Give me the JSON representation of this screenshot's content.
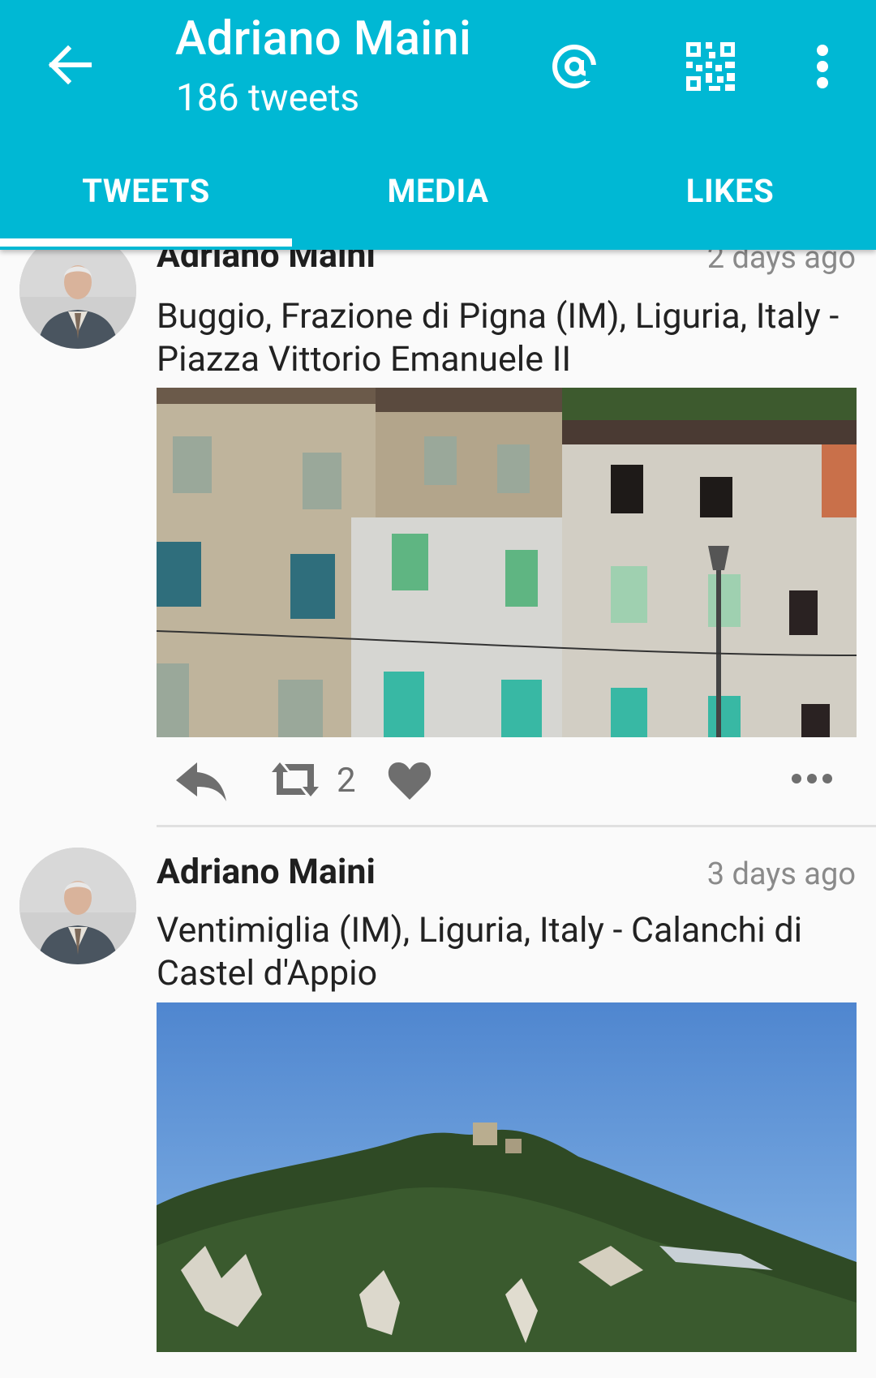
{
  "header": {
    "title": "Adriano Maini",
    "subtitle": "186 tweets",
    "accent_color": "#00b8d4",
    "icons": [
      "arrow-left-icon",
      "at-icon",
      "qr-code-icon",
      "overflow-menu-icon"
    ]
  },
  "tabs": [
    {
      "label": "TWEETS",
      "selected": true
    },
    {
      "label": "MEDIA",
      "selected": false
    },
    {
      "label": "LIKES",
      "selected": false
    }
  ],
  "tweets": [
    {
      "author": "Adriano Maini",
      "time": "2 days ago",
      "text": "Buggio, Frazione di Pigna (IM), Liguria, Italy - Piazza Vittorio Emanuele II",
      "retweet_count": "2",
      "photo": "village stone buildings with green shutters"
    },
    {
      "author": "Adriano Maini",
      "time": "3 days ago",
      "text": "Ventimiglia (IM), Liguria, Italy - Calanchi di Castel d'Appio",
      "photo": "green hill with castle ruins under blue sky"
    }
  ]
}
